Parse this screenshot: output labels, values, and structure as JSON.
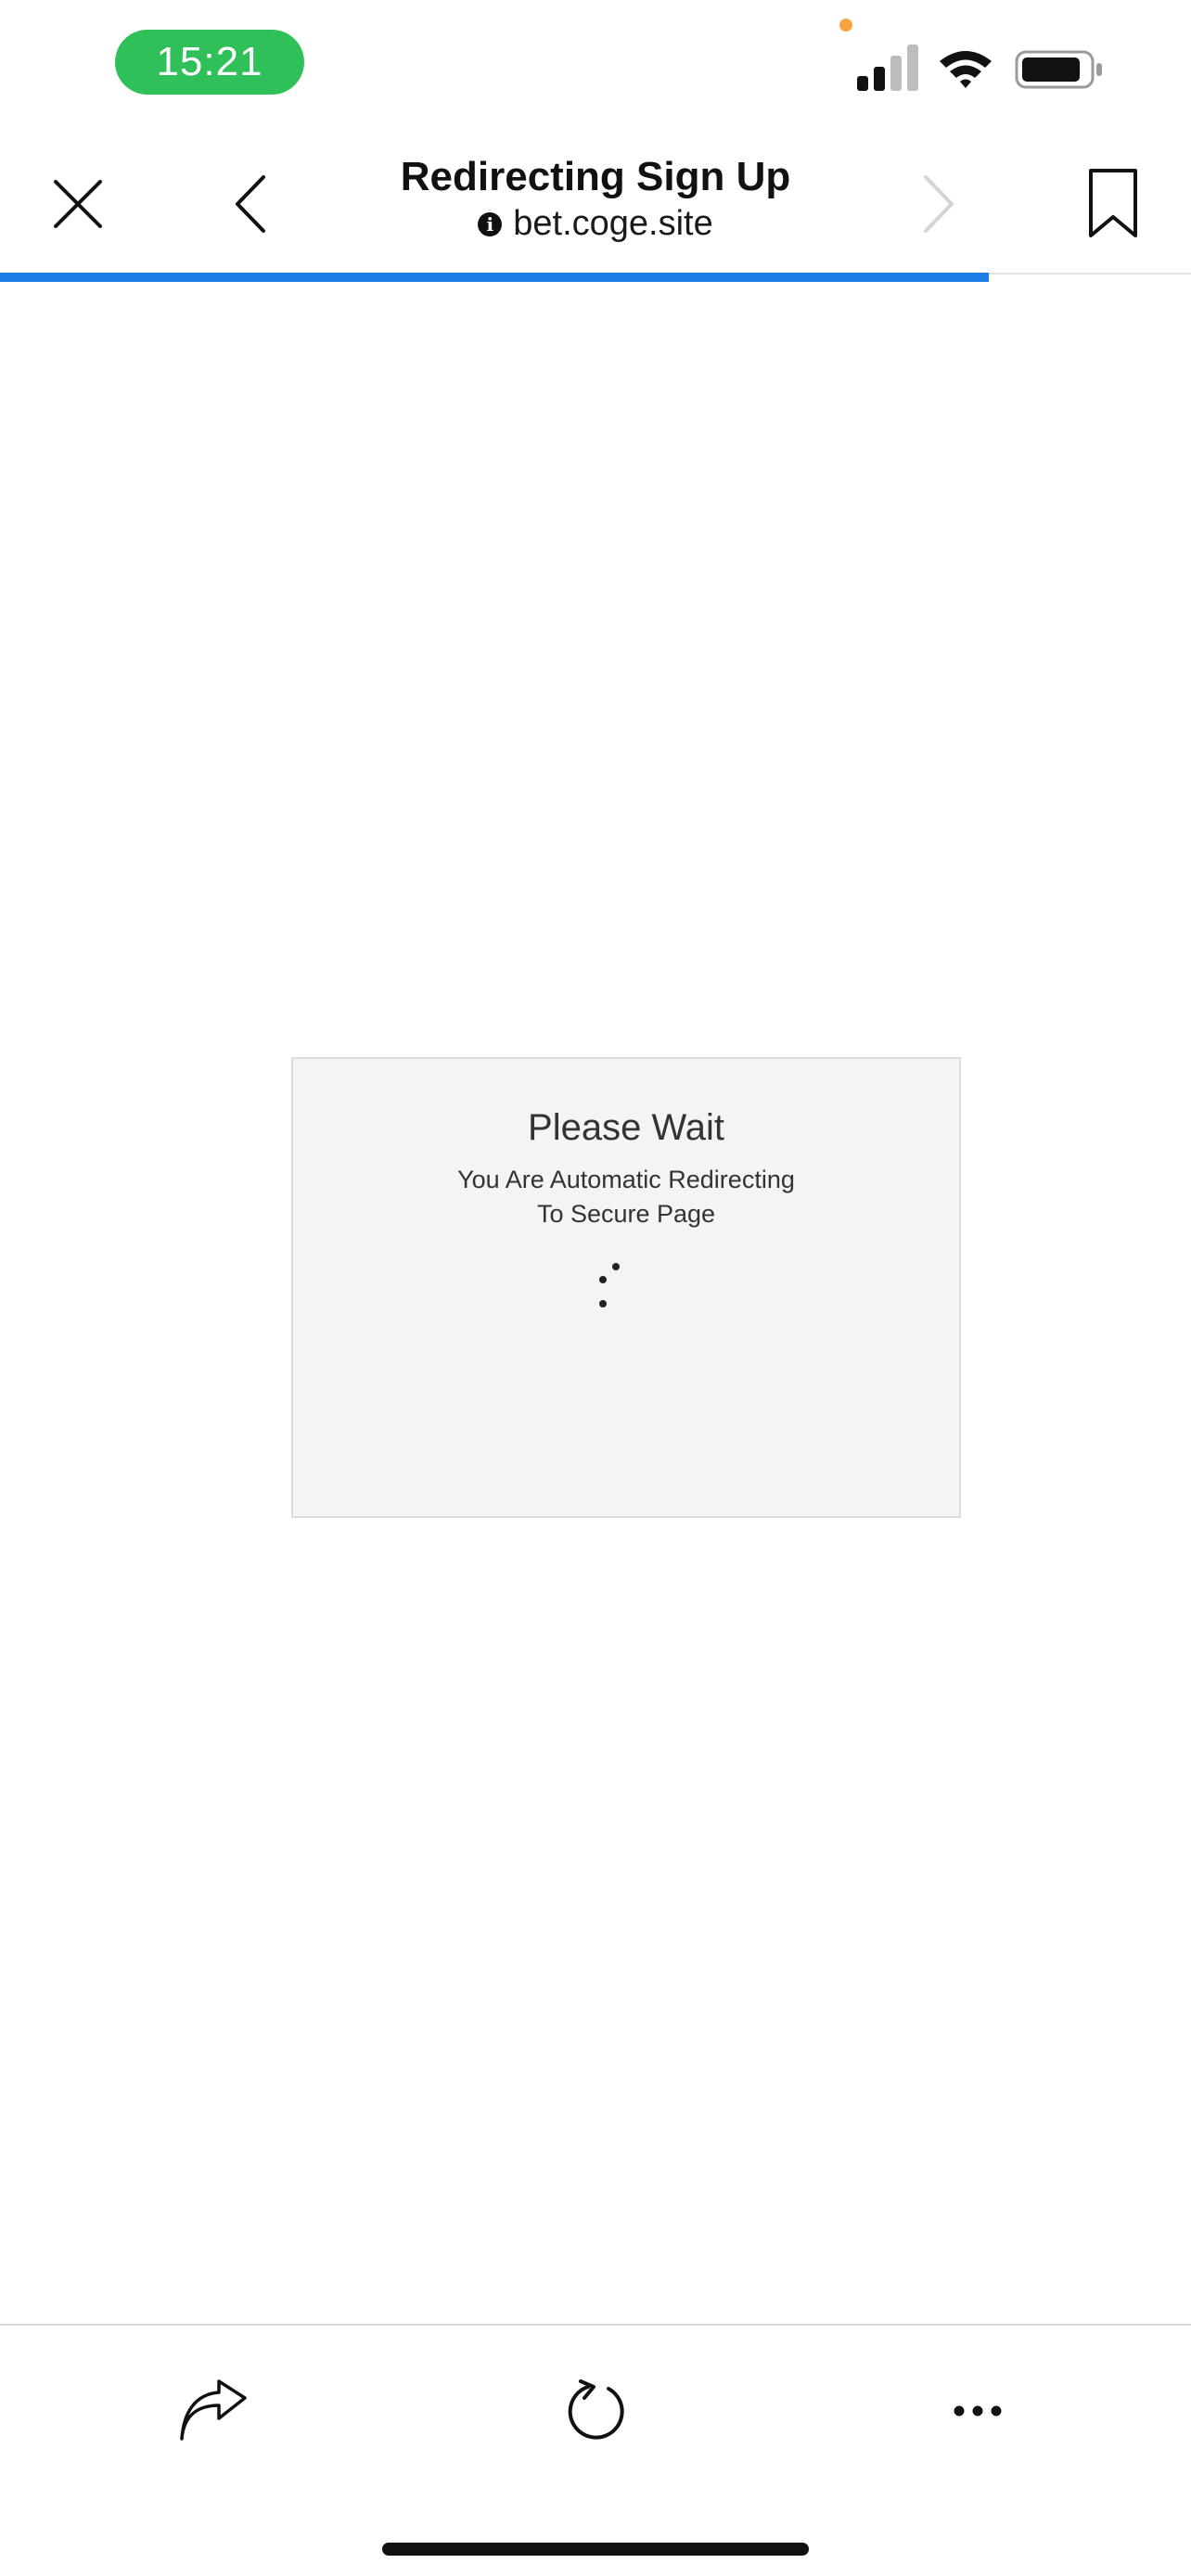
{
  "status_bar": {
    "time": "15:21",
    "time_pill_color": "#30c05a",
    "privacy_dot_color": "#f6a440",
    "signal_bars_active": 2,
    "signal_bars_total": 4
  },
  "nav": {
    "title": "Redirecting Sign Up",
    "url": "bet.coge.site",
    "info_glyph": "i",
    "close_icon": "close-icon",
    "back_icon": "chevron-left-icon",
    "forward_icon": "chevron-right-icon",
    "bookmark_icon": "bookmark-icon",
    "load_progress": 0.83,
    "progress_color": "#1a7ee6"
  },
  "content": {
    "wait_title": "Please Wait",
    "wait_line_1": "You Are Automatic Redirecting",
    "wait_line_2": "To Secure Page"
  },
  "toolbar": {
    "share_icon": "share-icon",
    "reload_icon": "reload-icon",
    "more_icon": "more-icon"
  }
}
